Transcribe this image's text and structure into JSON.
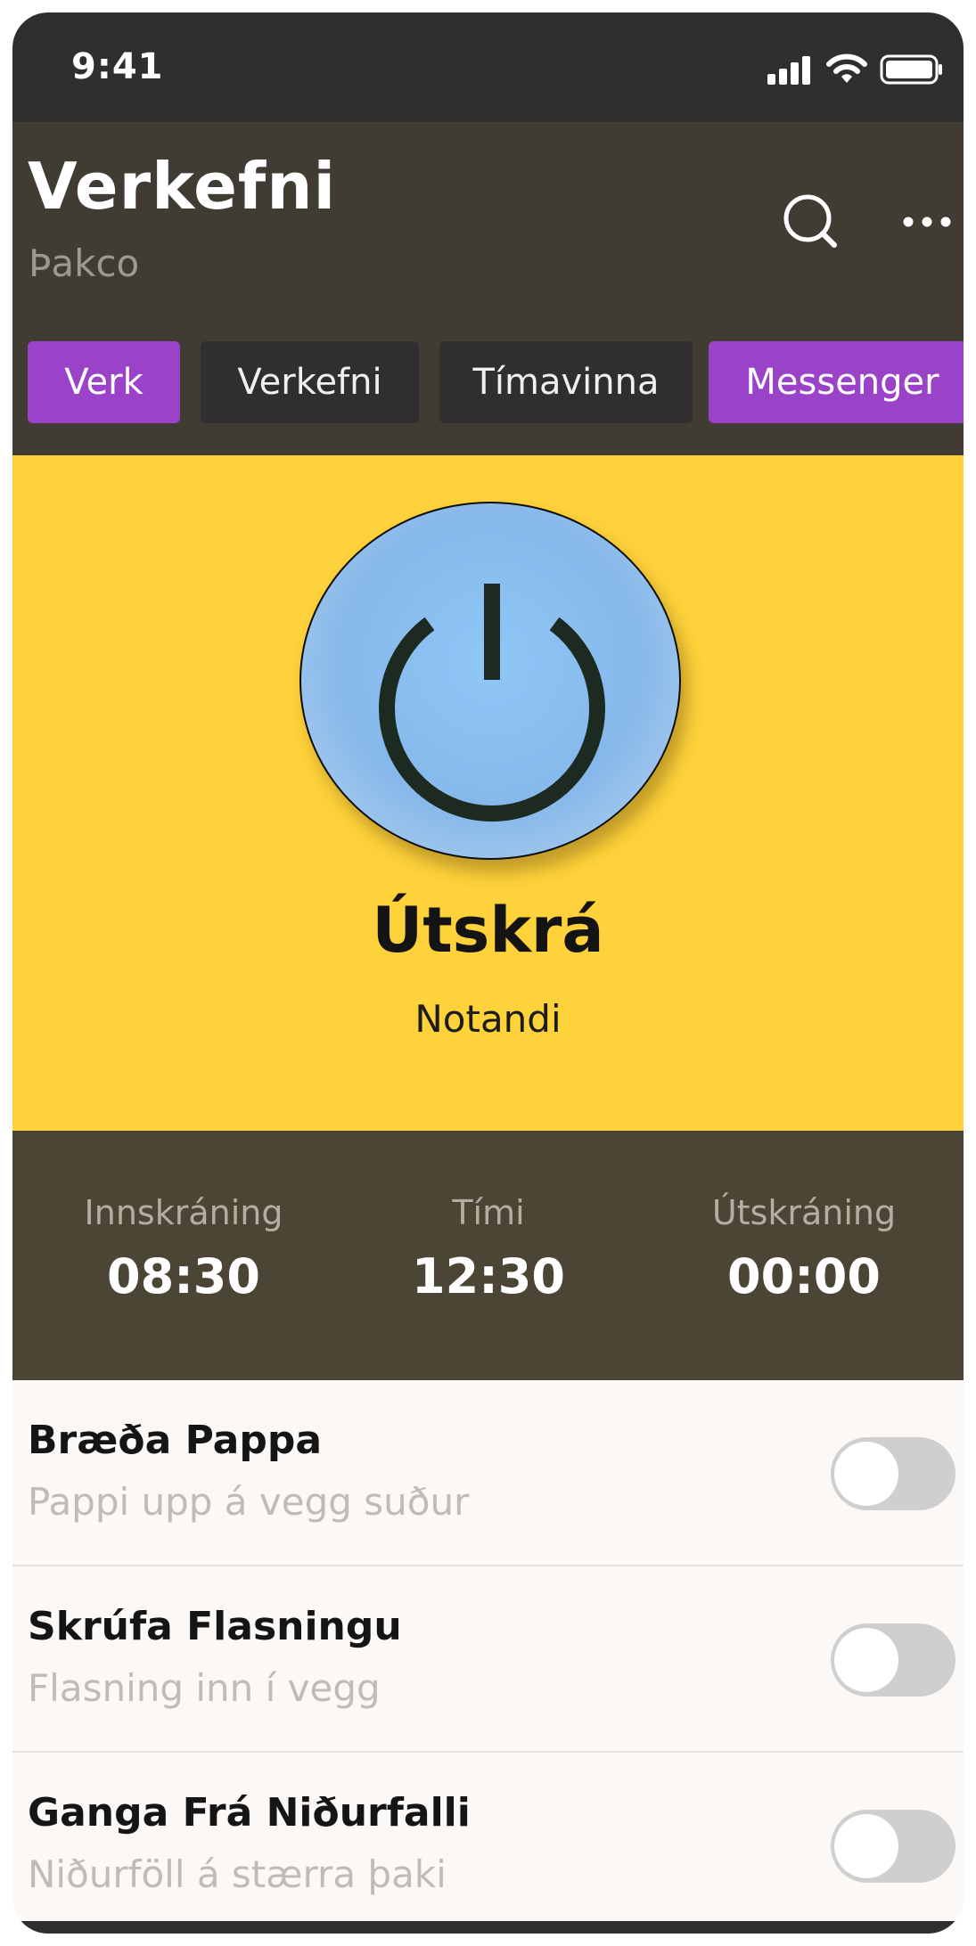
{
  "status_bar": {
    "time": "9:41",
    "icons": [
      "signal-icon",
      "wifi-icon",
      "battery-icon"
    ]
  },
  "header": {
    "title": "Verkefni",
    "subtitle": "Þakco",
    "actions": [
      "search-icon",
      "more-icon"
    ]
  },
  "tabs": [
    {
      "label": "Verk",
      "active": true
    },
    {
      "label": "Verkefni",
      "active": false
    },
    {
      "label": "Tímavinna",
      "active": false
    },
    {
      "label": "Messenger",
      "active": false
    }
  ],
  "hero": {
    "icon": "power-icon",
    "title": "Útskrá",
    "subtitle": "Notandi"
  },
  "stats": [
    {
      "label": "Innskráning",
      "value": "08:30"
    },
    {
      "label": "Tími",
      "value": "12:30"
    },
    {
      "label": "Útskráning",
      "value": "00:00"
    }
  ],
  "tasks": [
    {
      "title": "Bræða Pappa",
      "description": "Pappi upp á vegg suður",
      "enabled": false
    },
    {
      "title": "Skrúfa Flasningu",
      "description": "Flasning inn í vegg",
      "enabled": false
    },
    {
      "title": "Ganga Frá Niðurfalli",
      "description": "Niðurföll á stærra þaki",
      "enabled": false
    }
  ],
  "colors": {
    "status_bar": "#2f2f2f",
    "header": "#413c33",
    "accent_purple": "#9a43c9",
    "hero_yellow": "#fed23a",
    "stats_bg": "#4b4536",
    "power_button_blue": "#8fc7f7"
  }
}
